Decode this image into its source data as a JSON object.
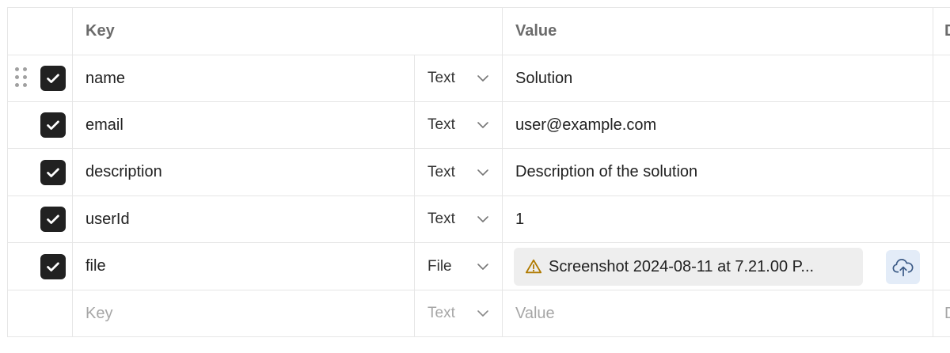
{
  "header": {
    "key": "Key",
    "value": "Value",
    "desc": "D"
  },
  "rows": [
    {
      "checked": true,
      "key": "name",
      "type": "Text",
      "value": "Solution"
    },
    {
      "checked": true,
      "key": "email",
      "type": "Text",
      "value": "user@example.com"
    },
    {
      "checked": true,
      "key": "description",
      "type": "Text",
      "value": "Description of the solution"
    },
    {
      "checked": true,
      "key": "userId",
      "type": "Text",
      "value": "1"
    },
    {
      "checked": true,
      "key": "file",
      "type": "File",
      "value": "Screenshot 2024-08-11 at 7.21.00 P..."
    }
  ],
  "new_row": {
    "key_placeholder": "Key",
    "type": "Text",
    "value_placeholder": "Value",
    "desc": "D"
  },
  "icons": {
    "drag": "drag-handle-icon",
    "check": "checkmark-icon",
    "chevron": "chevron-down-icon",
    "warning": "warning-icon",
    "upload": "cloud-upload-icon"
  },
  "colors": {
    "checkbox": "#212121",
    "upload_bg": "#e3ecf8",
    "upload_icon": "#3b5a86",
    "warning": "#b07a00"
  }
}
